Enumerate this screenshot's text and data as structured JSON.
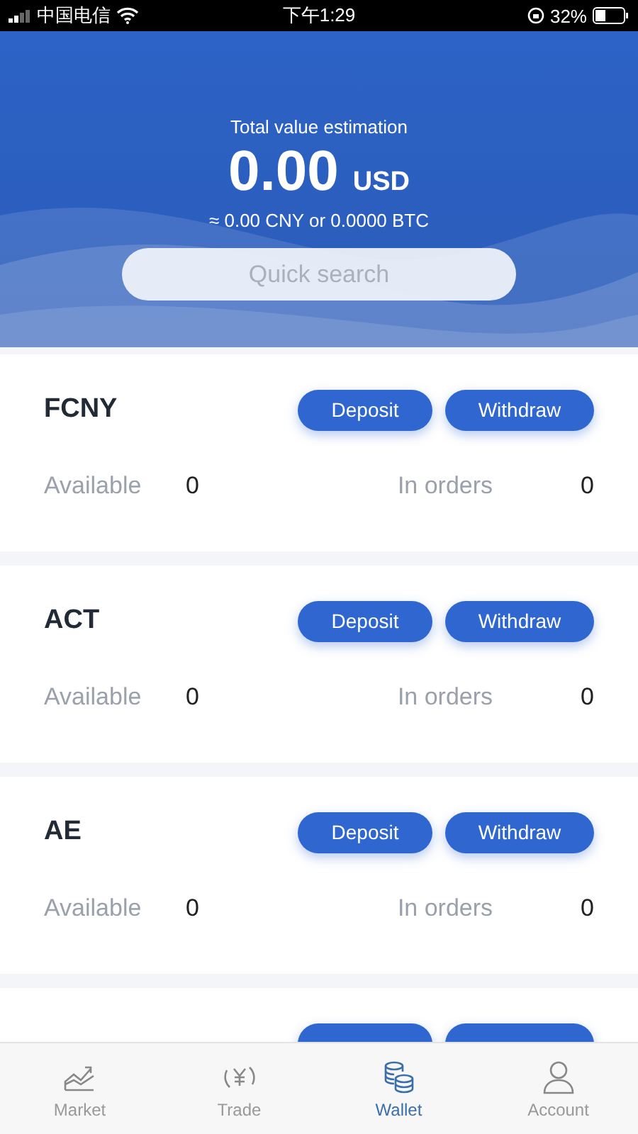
{
  "status_bar": {
    "carrier": "中国电信",
    "time": "下午1:29",
    "battery": "32%"
  },
  "header": {
    "label": "Total value estimation",
    "amount": "0.00",
    "currency": "USD",
    "equivalent": "≈ 0.00 CNY or 0.0000 BTC",
    "search": {
      "placeholder": "Quick search"
    }
  },
  "assets": [
    {
      "name": "FCNY",
      "deposit": "Deposit",
      "withdraw": "Withdraw",
      "available_label": "Available",
      "available": "0",
      "orders_label": "In orders",
      "orders": "0"
    },
    {
      "name": "ACT",
      "deposit": "Deposit",
      "withdraw": "Withdraw",
      "available_label": "Available",
      "available": "0",
      "orders_label": "In orders",
      "orders": "0"
    },
    {
      "name": "AE",
      "deposit": "Deposit",
      "withdraw": "Withdraw",
      "available_label": "Available",
      "available": "0",
      "orders_label": "In orders",
      "orders": "0"
    }
  ],
  "tabs": [
    {
      "label": "Market",
      "selected": false
    },
    {
      "label": "Trade",
      "selected": false
    },
    {
      "label": "Wallet",
      "selected": true
    },
    {
      "label": "Account",
      "selected": false
    }
  ]
}
